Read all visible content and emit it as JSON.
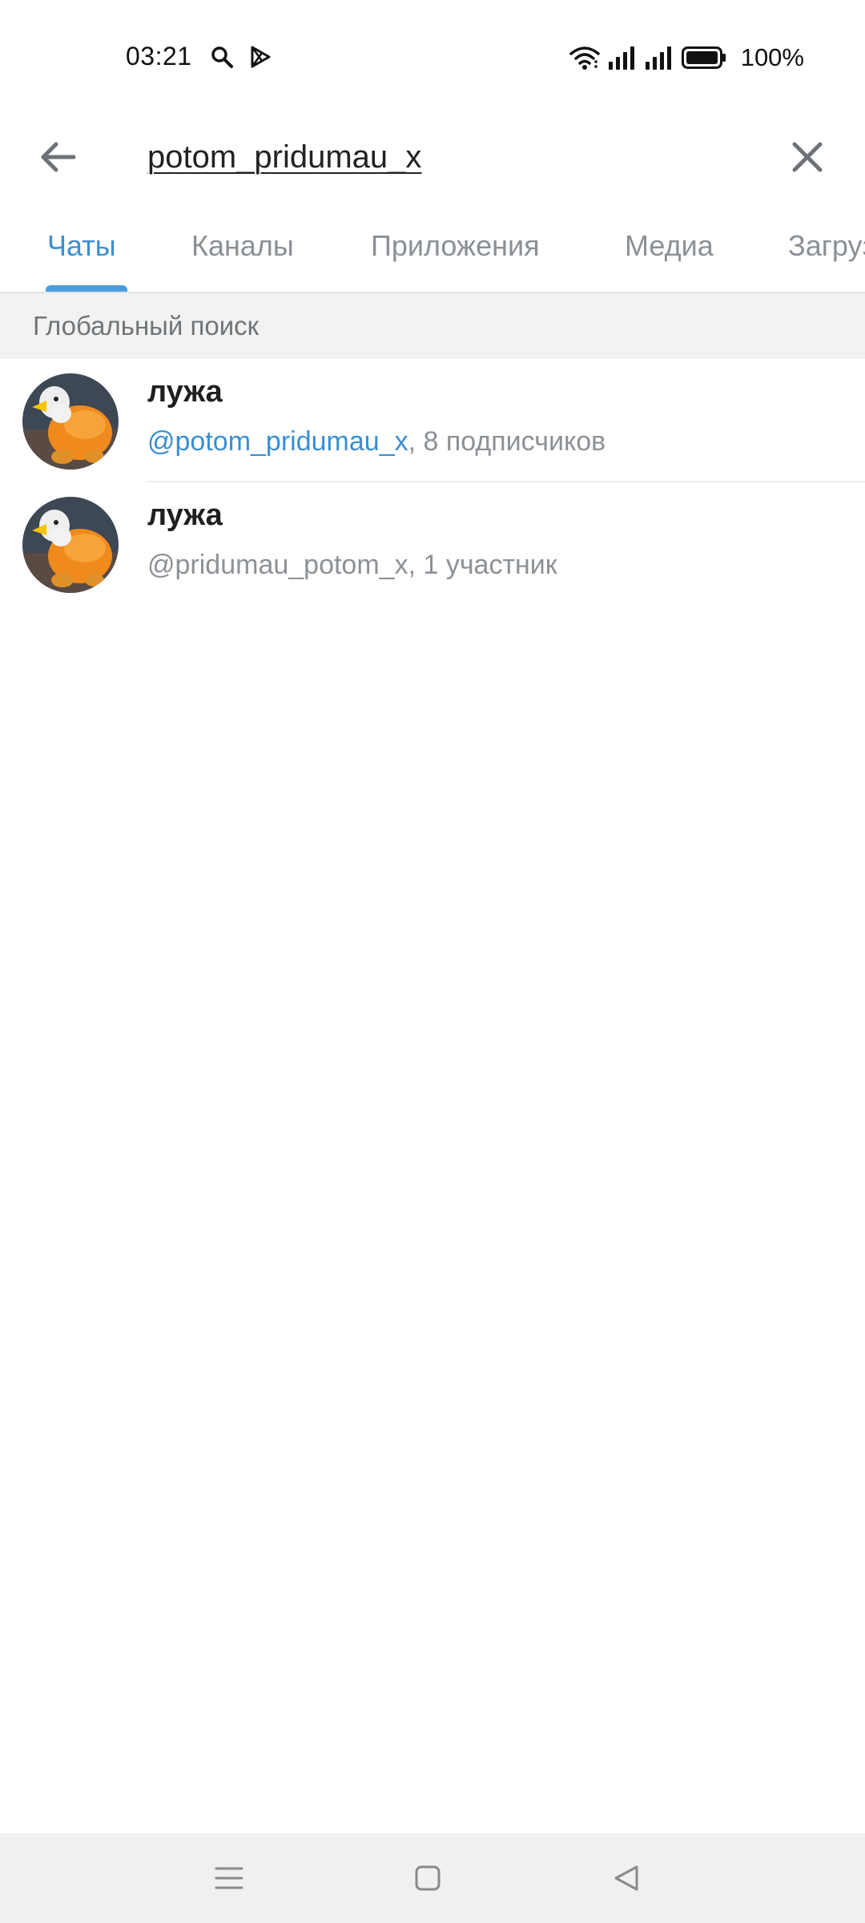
{
  "status_bar": {
    "time": "03:21",
    "battery": "100%",
    "icons": [
      "search-icon",
      "play-store-icon",
      "wifi-icon",
      "signal-icon",
      "signal-icon",
      "battery-icon"
    ]
  },
  "search": {
    "query": "potom_pridumau_x",
    "back_icon": "arrow-left-icon",
    "clear_icon": "close-icon"
  },
  "tabs": [
    {
      "label": "Чаты",
      "active": true
    },
    {
      "label": "Каналы",
      "active": false
    },
    {
      "label": "Приложения",
      "active": false
    },
    {
      "label": "Медиа",
      "active": false
    },
    {
      "label": "Загрузки",
      "active": false
    }
  ],
  "section": {
    "title": "Глобальный поиск"
  },
  "results": [
    {
      "title": "лужа",
      "username": "@potom_pridumau_x",
      "meta": ", 8 подписчиков",
      "username_highlighted": true
    },
    {
      "title": "лужа",
      "username": "@pridumau_potom_x",
      "meta": ", 1 участник",
      "username_highlighted": false
    }
  ],
  "nav_bar": {
    "icons": [
      "menu-icon",
      "home-square-icon",
      "back-triangle-icon"
    ]
  },
  "colors": {
    "accent": "#3b8fd0",
    "tab_inactive": "#8a9095",
    "section_bg": "#f2f2f2",
    "nav_bg": "#f0f0f0"
  }
}
